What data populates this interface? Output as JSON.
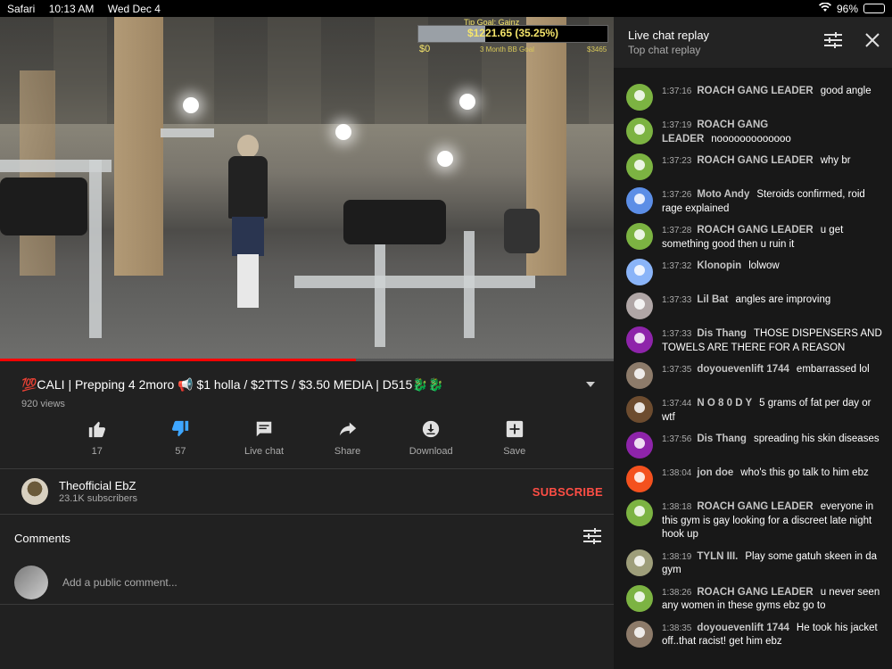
{
  "status_bar": {
    "app": "Safari",
    "time": "10:13 AM",
    "date": "Wed Dec 4",
    "battery": "96%",
    "battery_level": 0.96
  },
  "video": {
    "overlay": {
      "label": "Tip Goal: Gainz",
      "amount": "$1221.65 (35.25%)",
      "min": "$0",
      "goal_sub": "3 Month BB Goal",
      "max": "$3465",
      "progress": 0.3525
    },
    "title": "💯CALI |  Prepping 4 2moro  📢 $1 holla / $2TTS / $3.50 MEDIA |   D515🐉🐉",
    "views": "920 views",
    "played_fraction": 0.58
  },
  "actions": [
    {
      "label": "17",
      "icon": "thumb-up-icon"
    },
    {
      "label": "57",
      "icon": "thumb-down-icon"
    },
    {
      "label": "Live chat",
      "icon": "live-chat-icon"
    },
    {
      "label": "Share",
      "icon": "share-icon"
    },
    {
      "label": "Download",
      "icon": "download-icon"
    },
    {
      "label": "Save",
      "icon": "save-icon"
    }
  ],
  "channel": {
    "name": "Theofficial EbZ",
    "subscribers": "23.1K subscribers",
    "subscribe": "SUBSCRIBE"
  },
  "comments": {
    "label": "Comments",
    "placeholder": "Add a public comment..."
  },
  "chat": {
    "title": "Live chat replay",
    "subtitle": "Top chat replay",
    "messages": [
      {
        "time": "1:37:16",
        "author": "ROACH GANG LEADER",
        "text": "good angle",
        "color": "#7cb342"
      },
      {
        "time": "1:37:19",
        "author": "ROACH GANG LEADER",
        "text": "nooooooooooooo",
        "color": "#7cb342"
      },
      {
        "time": "1:37:23",
        "author": "ROACH GANG LEADER",
        "text": "why br",
        "color": "#7cb342"
      },
      {
        "time": "1:37:26",
        "author": "Moto Andy",
        "text": "Steroids confirmed, roid rage explained",
        "color": "#5c8ee6"
      },
      {
        "time": "1:37:28",
        "author": "ROACH GANG LEADER",
        "text": "u get something good then u ruin it",
        "color": "#7cb342"
      },
      {
        "time": "1:37:32",
        "author": "Klonopin",
        "text": "lolwow",
        "color": "#8ab4f8"
      },
      {
        "time": "1:37:33",
        "author": "Lil Bat",
        "text": "angles are improving",
        "color": "#b0a6a6"
      },
      {
        "time": "1:37:33",
        "author": "Dis Thang",
        "text": "THOSE DISPENSERS AND TOWELS ARE THERE FOR A REASON",
        "color": "#8e24aa"
      },
      {
        "time": "1:37:35",
        "author": "doyouevenlift 1744",
        "text": "embarrassed lol",
        "color": "#8d7b6a"
      },
      {
        "time": "1:37:44",
        "author": "N O 8 0 D Y",
        "text": "5 grams of fat per day or wtf",
        "color": "#6d4c2f"
      },
      {
        "time": "1:37:56",
        "author": "Dis Thang",
        "text": "spreading his skin diseases",
        "color": "#8e24aa"
      },
      {
        "time": "1:38:04",
        "author": "jon doe",
        "text": "who's this go talk to him ebz",
        "color": "#f4511e"
      },
      {
        "time": "1:38:18",
        "author": "ROACH GANG LEADER",
        "text": "everyone in this gym is gay looking for a discreet late night hook up",
        "color": "#7cb342"
      },
      {
        "time": "1:38:19",
        "author": "TYLN III.",
        "text": "Play some gatuh skeen in da gym",
        "color": "#9e9e7a"
      },
      {
        "time": "1:38:26",
        "author": "ROACH GANG LEADER",
        "text": "u never seen any women in these gyms ebz go to",
        "color": "#7cb342"
      },
      {
        "time": "1:38:35",
        "author": "doyouevenlift 1744",
        "text": "He took his jacket off..that racist! get him ebz",
        "color": "#8d7b6a"
      }
    ]
  }
}
